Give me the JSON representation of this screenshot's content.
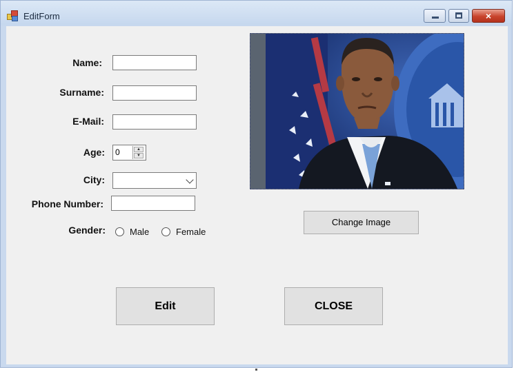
{
  "window": {
    "title": "EditForm",
    "icon": "form-app-icon",
    "controls": {
      "minimize": "minimize-icon",
      "maximize": "maximize-icon",
      "close": "×"
    }
  },
  "form": {
    "name": {
      "label": "Name:",
      "value": ""
    },
    "surname": {
      "label": "Surname:",
      "value": ""
    },
    "email": {
      "label": "E-Mail:",
      "value": ""
    },
    "age": {
      "label": "Age:",
      "value": "0",
      "up": "▲",
      "down": "▼"
    },
    "city": {
      "label": "City:",
      "value": ""
    },
    "phone": {
      "label": "Phone Number:",
      "value": ""
    },
    "gender": {
      "label": "Gender:",
      "options": [
        {
          "label": "Male",
          "selected": false
        },
        {
          "label": "Female",
          "selected": false
        }
      ]
    }
  },
  "image": {
    "name": "profile-photo"
  },
  "buttons": {
    "change_image": "Change Image",
    "edit": "Edit",
    "close": "CLOSE"
  },
  "colors": {
    "client_background": "#f0f0f0",
    "button_face": "#e1e1e1",
    "titlebar": "#c9d9ee",
    "close_button": "#c8432c"
  }
}
